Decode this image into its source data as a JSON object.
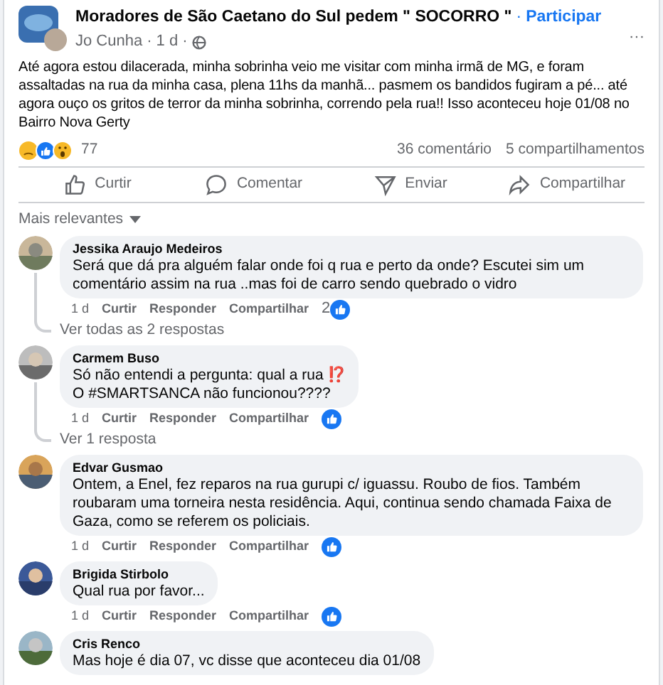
{
  "post": {
    "group": "Moradores de São Caetano do Sul pedem \" SOCORRO \"",
    "separator": "·",
    "join": "Participar",
    "author": "Jo Cunha",
    "time": "1 d",
    "dot": "·",
    "more": "···",
    "text": "Até agora estou dilacerada, minha sobrinha veio me visitar com minha irmã de MG, e foram assaltadas na rua da minha casa, plena 11hs da manhã... pasmem os bandidos fugiram a pé... até agora ouço os gritos de terror da minha sobrinha, correndo pela rua!! Isso aconteceu hoje 01/08 no Bairro Nova Gerty",
    "reaction_count": "77",
    "comments": "36 comentário",
    "shares": "5 compartilhamentos"
  },
  "actions": [
    {
      "kind": "like",
      "label": "Curtir"
    },
    {
      "kind": "comment",
      "label": "Comentar"
    },
    {
      "kind": "send",
      "label": "Enviar"
    },
    {
      "kind": "share",
      "label": "Compartilhar"
    }
  ],
  "sort": "Mais relevantes",
  "comments": [
    {
      "name": "Jessika Araujo Medeiros",
      "text": "Será que dá pra alguém falar onde foi q rua e perto da onde? Escutei sim um comentário assim na rua ..mas foi de carro sendo quebrado o vidro",
      "time": "1 d",
      "like": "Curtir",
      "reply": "Responder",
      "share": "Compartilhar",
      "likes": "2",
      "replies": "Ver todas as 2 respostas"
    },
    {
      "name": "Carmem Buso",
      "text": "Só não entendi a pergunta: qual a rua ⁉️\nO #SMARTSANCA não funcionou????",
      "time": "1 d",
      "like": "Curtir",
      "reply": "Responder",
      "share": "Compartilhar",
      "replies": "Ver 1 resposta"
    },
    {
      "name": "Edvar Gusmao",
      "text": "Ontem, a Enel, fez reparos na rua gurupi c/ iguassu. Roubo de fios. Também roubaram uma torneira nesta residência. Aqui, continua sendo chamada Faixa de Gaza, como se referem os policiais.",
      "time": "1 d",
      "like": "Curtir",
      "reply": "Responder",
      "share": "Compartilhar"
    },
    {
      "name": "Brigida Stirbolo",
      "text": "Qual rua por favor...",
      "time": "1 d",
      "like": "Curtir",
      "reply": "Responder",
      "share": "Compartilhar"
    },
    {
      "name": "Cris Renco",
      "text": "Mas hoje é dia 07, vc disse que aconteceu dia 01/08"
    }
  ]
}
